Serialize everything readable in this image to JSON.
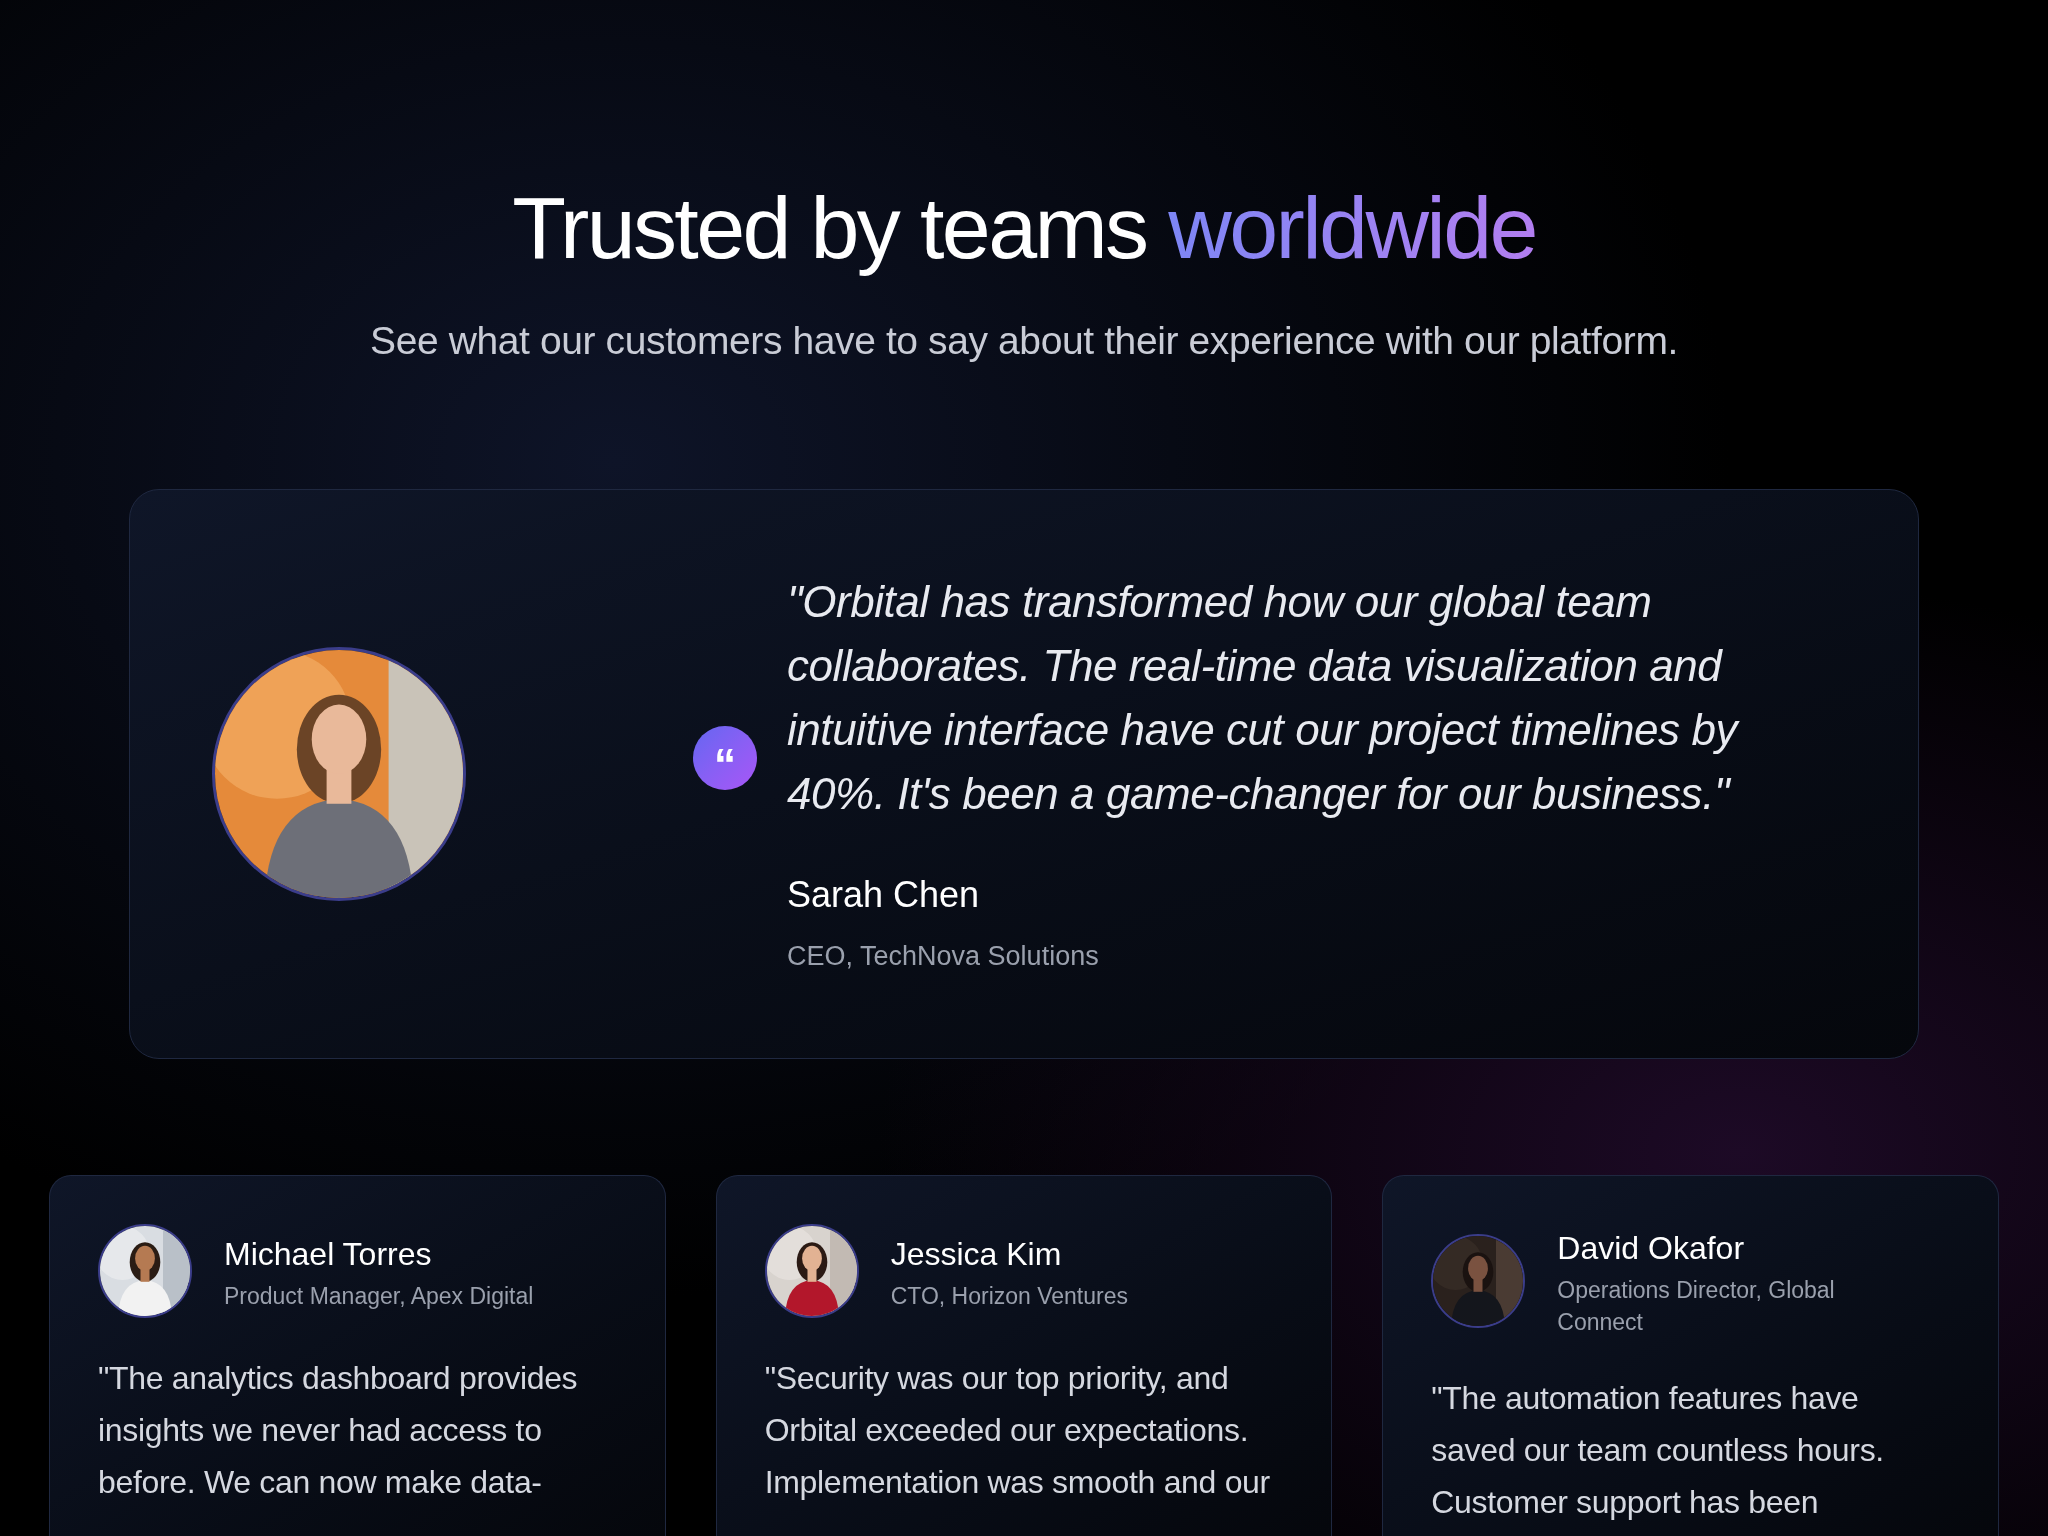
{
  "header": {
    "title": "Trusted by teams",
    "title_highlight": "worldwide",
    "subtitle": "See what our customers have to say about their experience with our platform."
  },
  "featured": {
    "quote_mark": "“",
    "quote": "\"Orbital has transformed how our global team collaborates. The real-time data visualization and intuitive interface have cut our project timelines by 40%. It's been a game-changer for our business.\"",
    "name": "Sarah Chen",
    "role": "CEO, TechNova Solutions"
  },
  "testimonials": [
    {
      "name": "Michael Torres",
      "role": "Product Manager, Apex Digital",
      "quote": "\"The analytics dashboard provides insights we never had access to before. We can now make data-"
    },
    {
      "name": "Jessica Kim",
      "role": "CTO, Horizon Ventures",
      "quote": "\"Security was our top priority, and Orbital exceeded our expectations. Implementation was smooth and our"
    },
    {
      "name": "David Okafor",
      "role": "Operations Director, Global Connect",
      "quote": "\"The automation features have saved our team countless hours. Customer support has been"
    }
  ]
}
